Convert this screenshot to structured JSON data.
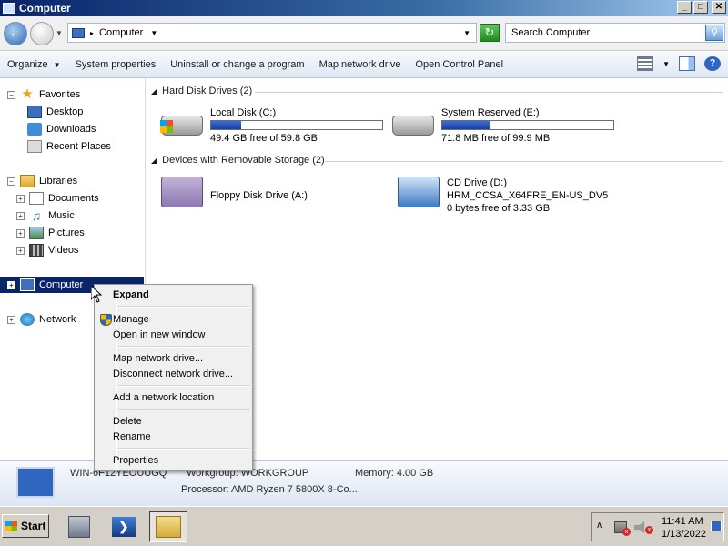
{
  "window": {
    "title": "Computer"
  },
  "address": {
    "crumb": "Computer"
  },
  "search": {
    "placeholder": "Search Computer"
  },
  "toolbar": {
    "items": [
      "Organize",
      "System properties",
      "Uninstall or change a program",
      "Map network drive",
      "Open Control Panel"
    ]
  },
  "nav": {
    "favorites": "Favorites",
    "desktop": "Desktop",
    "downloads": "Downloads",
    "recent": "Recent Places",
    "libraries": "Libraries",
    "documents": "Documents",
    "music": "Music",
    "pictures": "Pictures",
    "videos": "Videos",
    "computer": "Computer",
    "network": "Network"
  },
  "groups": {
    "hdd": "Hard Disk Drives (2)",
    "removable": "Devices with Removable Storage (2)"
  },
  "drives": {
    "c": {
      "name": "Local Disk (C:)",
      "free": "49.4 GB free of 59.8 GB",
      "used_fraction": 0.174
    },
    "e": {
      "name": "System Reserved (E:)",
      "free": "71.8 MB free of 99.9 MB",
      "used_fraction": 0.281
    },
    "a": {
      "name": "Floppy Disk Drive (A:)"
    },
    "d": {
      "name": "CD Drive (D:)",
      "label": "HRM_CCSA_X64FRE_EN-US_DV5",
      "free": "0 bytes free of 3.33 GB"
    }
  },
  "details": {
    "computer_name": "WIN-6F12YEOUUGQ",
    "workgroup": "Workgroup: WORKGROUP",
    "memory": "Memory: 4.00 GB",
    "processor": "Processor: AMD Ryzen 7 5800X 8-Co..."
  },
  "context_menu": {
    "expand": "Expand",
    "manage": "Manage",
    "open_new": "Open in new window",
    "map_drive": "Map network drive...",
    "disconnect": "Disconnect network drive...",
    "add_location": "Add a network location",
    "delete": "Delete",
    "rename": "Rename",
    "properties": "Properties"
  },
  "taskbar": {
    "start": "Start",
    "time": "11:41 AM",
    "date": "1/13/2022"
  }
}
